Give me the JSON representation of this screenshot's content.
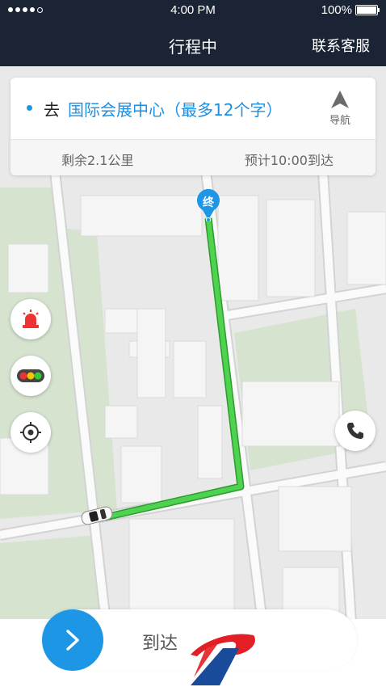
{
  "status_bar": {
    "time": "4:00 PM",
    "battery": "100%"
  },
  "header": {
    "title": "行程中",
    "right_action": "联系客服"
  },
  "trip_card": {
    "prefix": "去",
    "destination": "国际会展中心（最多12个字）",
    "nav_label": "导航",
    "remaining": "剩余2.1公里",
    "eta": "预计10:00到达"
  },
  "map": {
    "end_marker": "终",
    "route_color": "#3cc83c"
  },
  "side_buttons": {
    "left": [
      "alarm-icon",
      "traffic-light-icon",
      "locate-icon"
    ],
    "right": [
      "phone-icon"
    ]
  },
  "slider": {
    "label": "到达",
    "icon": "chevron-right-icon"
  },
  "colors": {
    "accent": "#1e96e6",
    "header_bg": "#1b2434"
  }
}
